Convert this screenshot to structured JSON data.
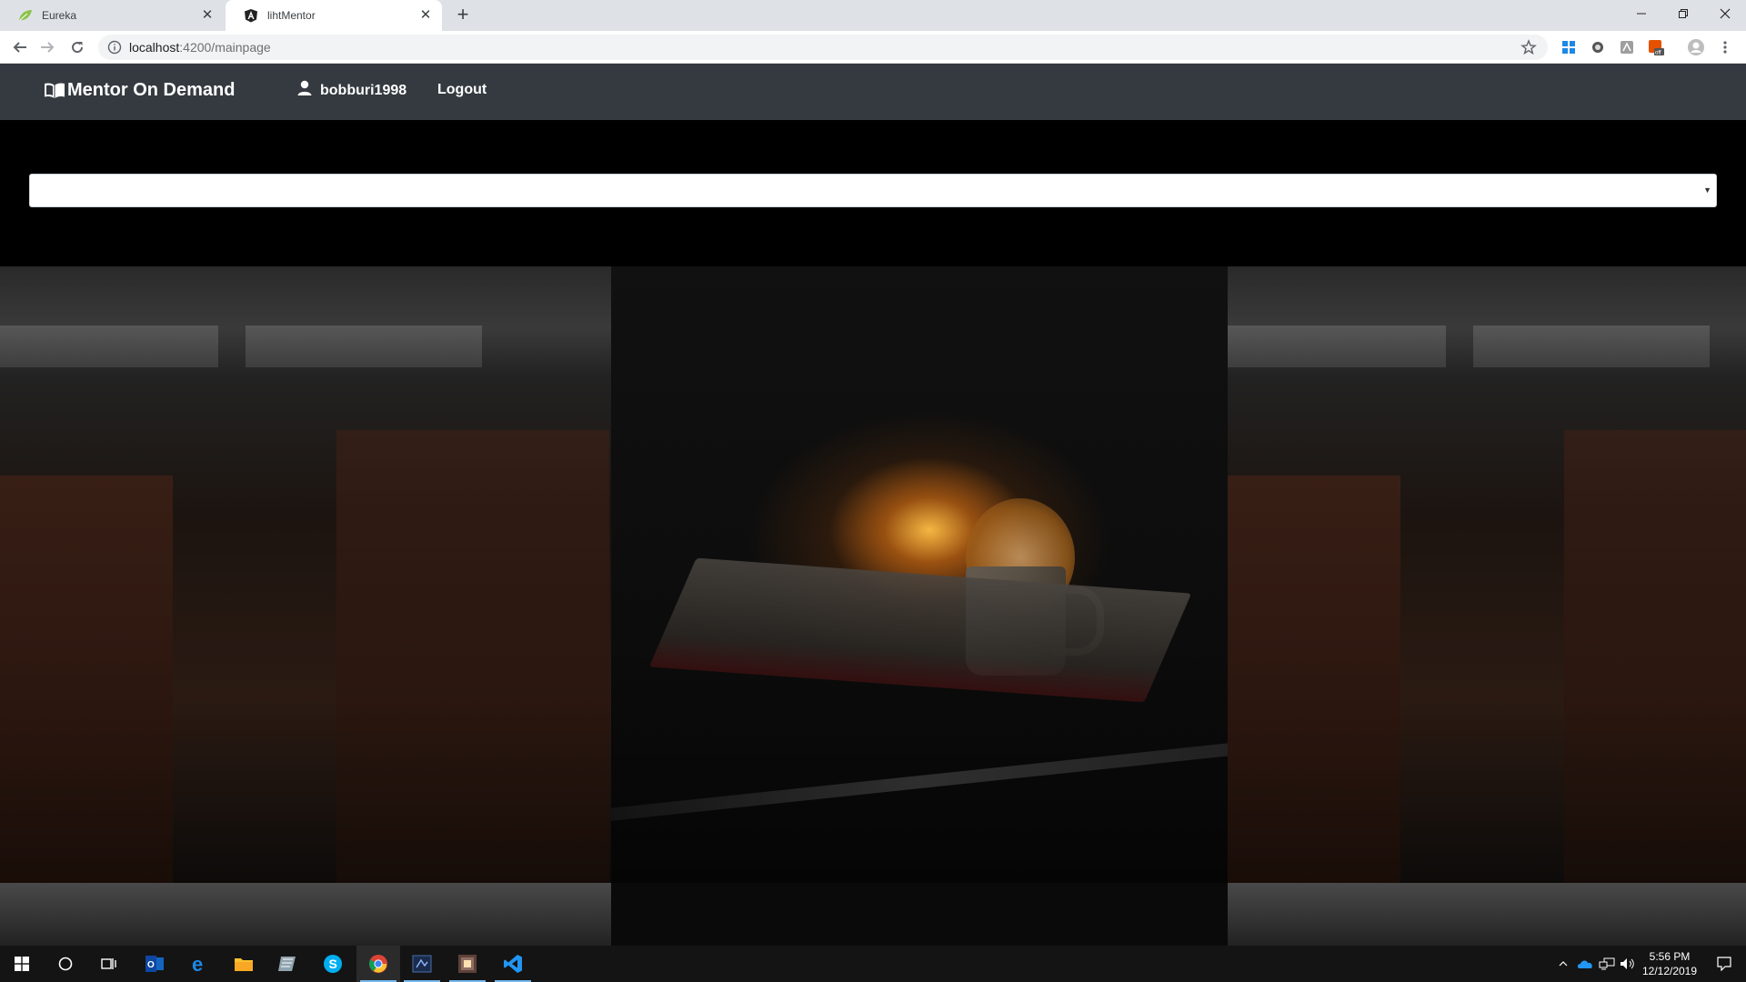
{
  "browser": {
    "tabs": [
      {
        "title": "Eureka",
        "active": false,
        "icon": "spring-leaf-icon"
      },
      {
        "title": "lihtMentor",
        "active": true,
        "icon": "angular-icon"
      }
    ],
    "new_tab_label": "+",
    "url_host": "localhost",
    "url_path": ":4200/mainpage"
  },
  "app": {
    "brand": "Mentor On Demand",
    "username": "bobburi1998",
    "logout_label": "Logout"
  },
  "select": {
    "value": ""
  },
  "taskbar": {
    "time": "5:56 PM",
    "date": "12/12/2019"
  },
  "colors": {
    "navbar_bg": "#343a40",
    "tabstrip_bg": "#dee1e6",
    "page_bg": "#000000",
    "taskbar_bg": "#141414"
  }
}
